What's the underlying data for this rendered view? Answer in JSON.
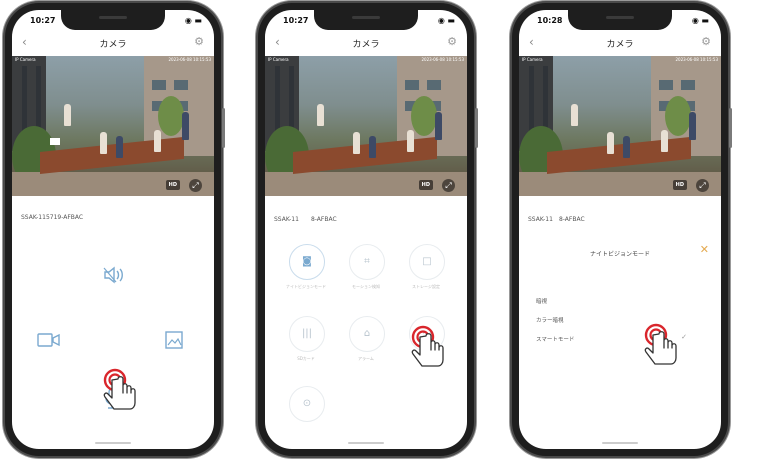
{
  "phones": [
    {
      "time": "10:27",
      "title": "カメラ",
      "device_name": "SSAK-115719-AFBAC",
      "camera_label": "IP Camera",
      "timestamp": "2023-06-08 10:15:53",
      "hd_label": "HD",
      "controls": [
        "speaker-icon",
        "video-record-icon",
        "screenshot-icon",
        "microphone-icon"
      ]
    },
    {
      "time": "10:27",
      "title": "カメラ",
      "device_name": "SSAK-11　　8-AFBAC",
      "camera_label": "IP Camera",
      "timestamp": "2023-06-08 10:15:53",
      "hd_label": "HD",
      "menu": [
        {
          "icon": "night-vision-icon",
          "label": "ナイトビジョンモード"
        },
        {
          "icon": "motion-detection-icon",
          "label": "モーション検知"
        },
        {
          "icon": "storage-icon",
          "label": "ストレージ設定"
        },
        {
          "icon": "sd-card-icon",
          "label": "SDカード"
        },
        {
          "icon": "alarm-icon",
          "label": "アラーム"
        },
        {
          "icon": "more-icon",
          "label": ""
        },
        {
          "icon": "location-icon",
          "label": ""
        }
      ]
    },
    {
      "time": "10:28",
      "title": "カメラ",
      "device_name": "SSAK-11　8-AFBAC",
      "camera_label": "IP Camera",
      "timestamp": "2023-06-08 10:15:53",
      "hd_label": "HD",
      "sheet_title": "ナイトビジョンモード",
      "options": [
        "暗視",
        "カラー暗視",
        "スマートモード"
      ]
    }
  ],
  "colors": {
    "accent_blue": "#7aa9cf",
    "close_orange": "#e4a94f",
    "hand_red": "#d9262c"
  }
}
